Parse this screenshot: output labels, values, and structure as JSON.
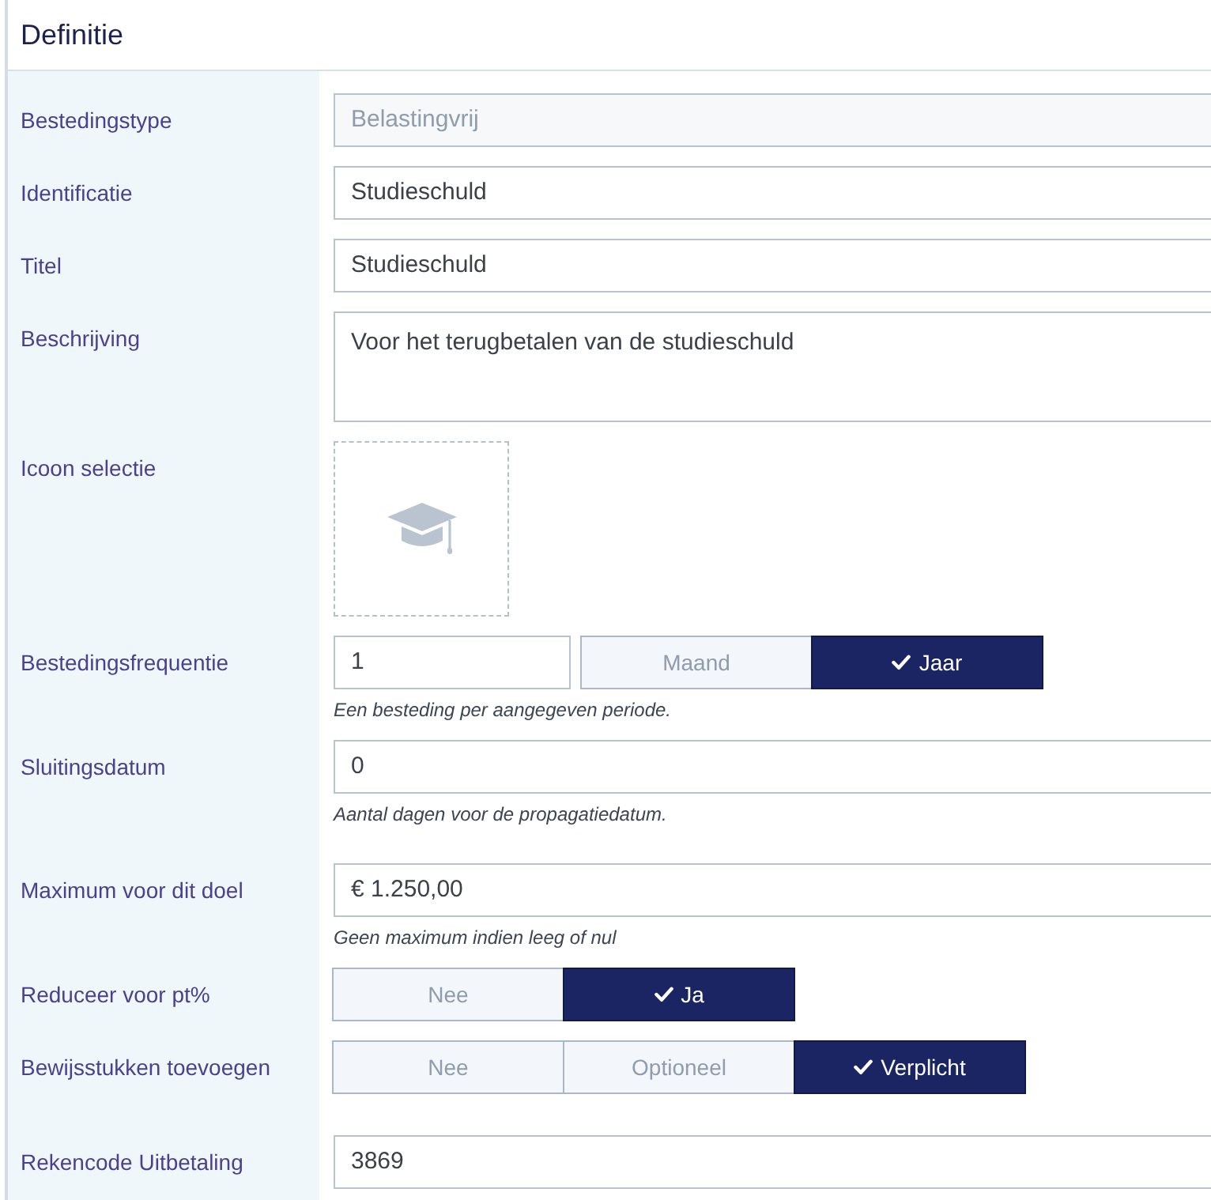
{
  "panel": {
    "title": "Definitie"
  },
  "fields": [
    {
      "kind": "text",
      "label": "Bestedingstype",
      "value": "Belastingvrij",
      "disabled": true
    },
    {
      "kind": "text",
      "label": "Identificatie",
      "value": "Studieschuld",
      "disabled": false
    },
    {
      "kind": "text",
      "label": "Titel",
      "value": "Studieschuld",
      "disabled": false
    },
    {
      "kind": "textarea",
      "label": "Beschrijving",
      "value": "Voor het terugbetalen van de studieschuld",
      "disabled": false
    },
    {
      "kind": "icon_picker",
      "label": "Icoon selectie"
    },
    {
      "kind": "number_period",
      "label": "Bestedingsfrequentie",
      "value": "1",
      "disabled": false,
      "options": [
        {
          "label": "Maand",
          "selected": false
        },
        {
          "label": "Jaar",
          "selected": true
        }
      ],
      "help": "Een besteding per aangegeven periode."
    },
    {
      "kind": "text",
      "label": "Sluitingsdatum",
      "value": "0",
      "disabled": false,
      "help": "Aantal dagen voor de propagatiedatum."
    },
    {
      "kind": "text",
      "label": "Maximum voor dit doel",
      "value": "€ 1.250,00",
      "disabled": false,
      "help": "Geen maximum indien leeg of nul"
    },
    {
      "kind": "choice",
      "label": "Reduceer voor pt%",
      "options": [
        {
          "label": "Nee",
          "selected": false
        },
        {
          "label": "Ja",
          "selected": true
        }
      ]
    },
    {
      "kind": "choice",
      "label": "Bewijsstukken toevoegen",
      "options": [
        {
          "label": "Nee",
          "selected": false
        },
        {
          "label": "Optioneel",
          "selected": false
        },
        {
          "label": "Verplicht",
          "selected": true
        }
      ]
    },
    {
      "kind": "text",
      "label": "Rekencode Uitbetaling",
      "value": "3869",
      "disabled": false
    }
  ]
}
